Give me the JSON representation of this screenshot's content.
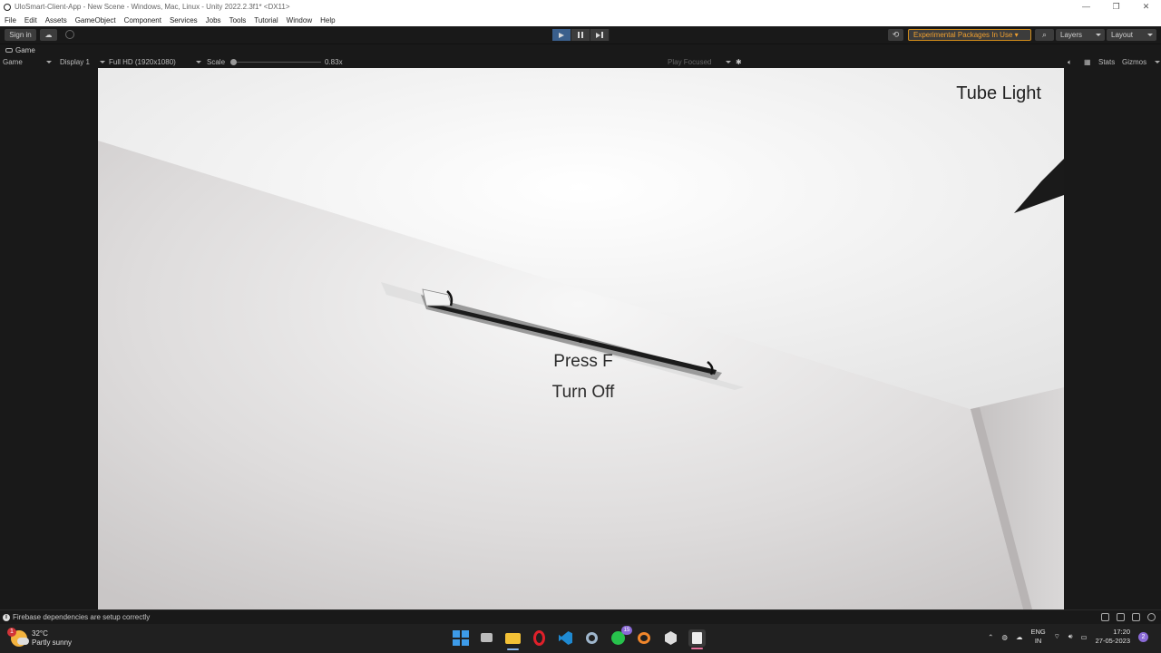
{
  "window": {
    "title": "UloSmart-Client-App - New Scene - Windows, Mac, Linux - Unity 2022.2.3f1* <DX11>",
    "minimize": "—",
    "restore": "❐",
    "close": "✕"
  },
  "menu": [
    "File",
    "Edit",
    "Assets",
    "GameObject",
    "Component",
    "Services",
    "Jobs",
    "Tools",
    "Tutorial",
    "Window",
    "Help"
  ],
  "toolbar": {
    "sign_in": "Sign in",
    "experimental": "Experimental Packages In Use ▾",
    "layers": "Layers",
    "layout": "Layout"
  },
  "tab": {
    "label": "Game"
  },
  "gamebar": {
    "mode": "Game",
    "display": "Display 1",
    "resolution": "Full HD (1920x1080)",
    "scale_label": "Scale",
    "scale_value": "0.83x",
    "play_focused": "Play Focused",
    "stats": "Stats",
    "gizmos": "Gizmos"
  },
  "scene": {
    "object_name": "Tube Light",
    "prompt": "Press F",
    "action": "Turn Off"
  },
  "status": {
    "message": "Firebase dependencies are setup correctly"
  },
  "taskbar": {
    "temperature": "32°C",
    "condition": "Partly sunny",
    "weather_badge": "1",
    "whatsapp_badge": "15",
    "lang": "ENG",
    "region": "IN",
    "time": "17:20",
    "date": "27-05-2023",
    "notif_count": "2"
  }
}
